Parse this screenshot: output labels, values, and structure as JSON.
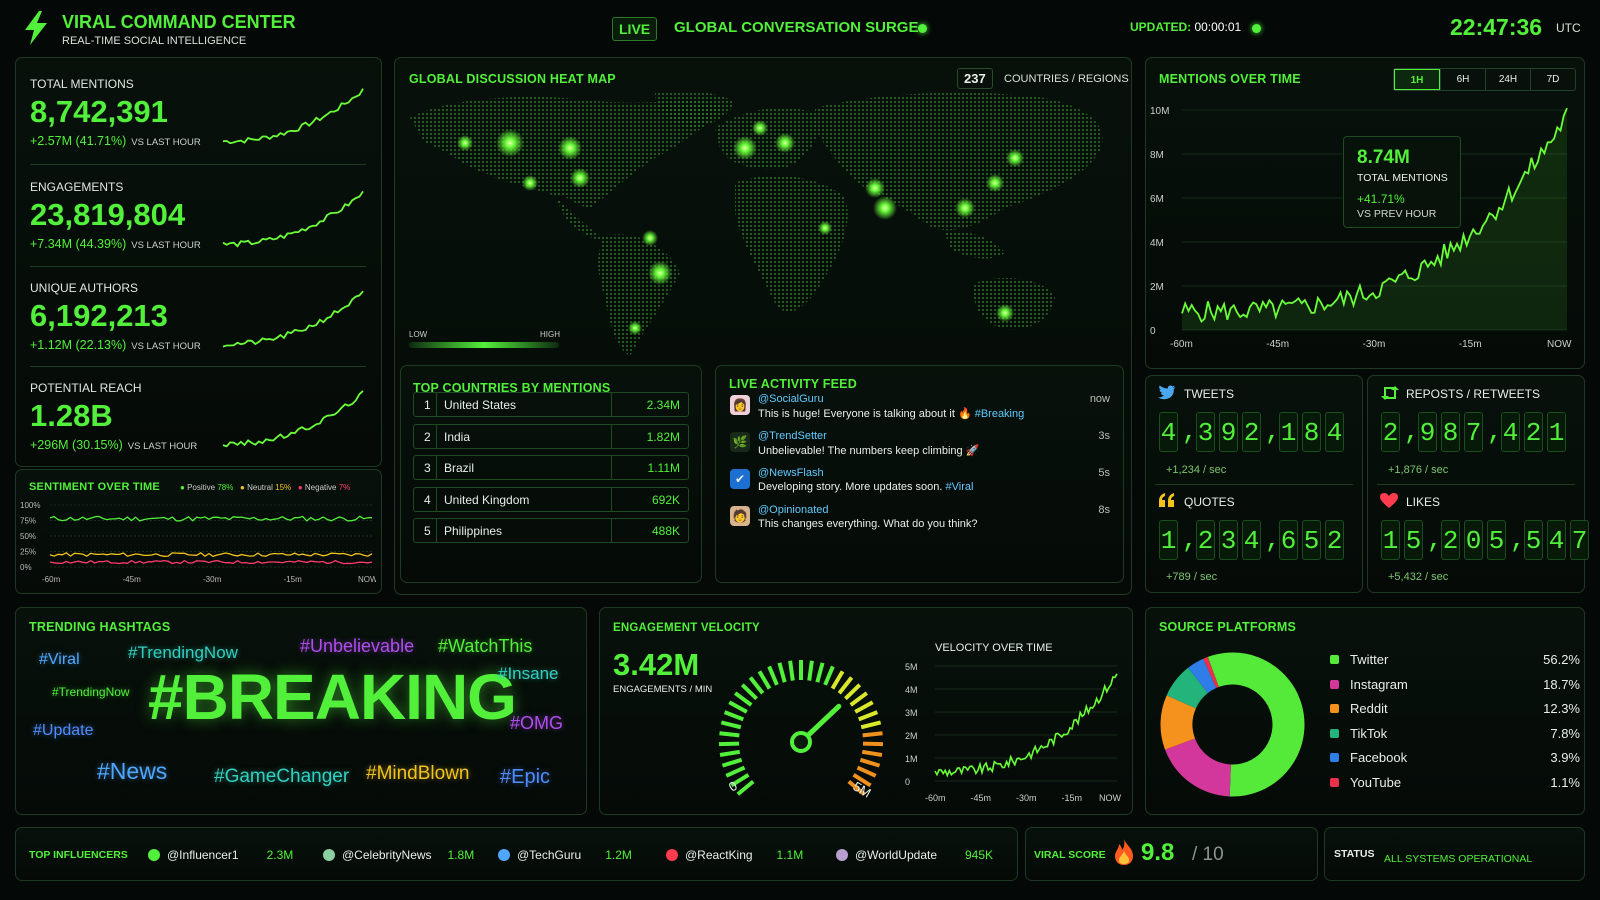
{
  "header": {
    "title": "VIRAL COMMAND CENTER",
    "subtitle": "REAL-TIME SOCIAL INTELLIGENCE",
    "live": "LIVE",
    "surge": "GLOBAL CONVERSATION SURGE",
    "updated_label": "UPDATED:",
    "updated_value": "00:00:01",
    "clock": "22:47:36",
    "tz": "UTC"
  },
  "kpis": [
    {
      "label": "TOTAL MENTIONS",
      "value": "8,742,391",
      "change": "+2.57M (41.71%)",
      "suffix": "VS LAST HOUR"
    },
    {
      "label": "ENGAGEMENTS",
      "value": "23,819,804",
      "change": "+7.34M (44.39%)",
      "suffix": "VS LAST HOUR"
    },
    {
      "label": "UNIQUE AUTHORS",
      "value": "6,192,213",
      "change": "+1.12M (22.13%)",
      "suffix": "VS LAST HOUR"
    },
    {
      "label": "POTENTIAL REACH",
      "value": "1.28B",
      "change": "+296M (30.15%)",
      "suffix": "VS LAST HOUR"
    }
  ],
  "sentiment": {
    "title": "SENTIMENT OVER TIME",
    "legend": [
      {
        "name": "Positive",
        "pct": "78%",
        "color": "#52f03a"
      },
      {
        "name": "Neutral",
        "pct": "15%",
        "color": "#f2c21d"
      },
      {
        "name": "Negative",
        "pct": "7%",
        "color": "#ff3b6e"
      }
    ],
    "yticks": [
      "100%",
      "75%",
      "50%",
      "25%",
      "0%"
    ],
    "xticks": [
      "-60m",
      "-45m",
      "-30m",
      "-15m",
      "NOW"
    ]
  },
  "heatmap": {
    "title": "GLOBAL DISCUSSION HEAT MAP",
    "count": "237",
    "count_label": "COUNTRIES / REGIONS",
    "low": "LOW",
    "high": "HIGH"
  },
  "countries": {
    "title": "TOP COUNTRIES BY MENTIONS",
    "rows": [
      {
        "rank": "1",
        "name": "United States",
        "value": "2.34M"
      },
      {
        "rank": "2",
        "name": "India",
        "value": "1.82M"
      },
      {
        "rank": "3",
        "name": "Brazil",
        "value": "1.11M"
      },
      {
        "rank": "4",
        "name": "United Kingdom",
        "value": "692K"
      },
      {
        "rank": "5",
        "name": "Philippines",
        "value": "488K"
      }
    ]
  },
  "feed": {
    "title": "LIVE ACTIVITY FEED",
    "items": [
      {
        "handle": "@SocialGuru",
        "text": "This is huge! Everyone is talking about it 🔥",
        "tag": "#Breaking",
        "time": "now"
      },
      {
        "handle": "@TrendSetter",
        "text": "Unbelievable! The numbers keep climbing 🚀",
        "tag": "",
        "time": "3s"
      },
      {
        "handle": "@NewsFlash",
        "text": "Developing story. More updates soon.",
        "tag": "#Viral",
        "time": "5s"
      },
      {
        "handle": "@Opinionated",
        "text": "This changes everything. What do you think?",
        "tag": "",
        "time": "8s"
      }
    ]
  },
  "mentions_chart": {
    "title": "MENTIONS OVER TIME",
    "ranges": [
      "1H",
      "6H",
      "24H",
      "7D"
    ],
    "selected": "1H",
    "callout_value": "8.74M",
    "callout_label": "TOTAL MENTIONS",
    "callout_change": "+41.71%",
    "callout_sub": "VS PREV HOUR"
  },
  "counters": [
    {
      "label": "TWEETS",
      "digits": "4,392,184",
      "rate": "+1,234 / sec",
      "icon": "twitter-icon"
    },
    {
      "label": "REPOSTS / RETWEETS",
      "digits": "2,987,421",
      "rate": "+1,876 / sec",
      "icon": "repost-icon"
    },
    {
      "label": "QUOTES",
      "digits": "1,234,652",
      "rate": "+789 / sec",
      "icon": "quote-icon"
    },
    {
      "label": "LIKES",
      "digits": "15,205,547",
      "rate": "+5,432 / sec",
      "icon": "heart-icon"
    }
  ],
  "hashtags": {
    "title": "TRENDING HASHTAGS",
    "items": [
      "#BREAKING",
      "#Viral",
      "#TrendingNow",
      "#Unbelievable",
      "#WatchThis",
      "#Insane",
      "#TrendingNow",
      "#Update",
      "#OMG",
      "#News",
      "#GameChanger",
      "#MindBlown",
      "#Epic"
    ]
  },
  "velocity": {
    "title": "ENGAGEMENT VELOCITY",
    "value": "3.42M",
    "unit": "ENGAGEMENTS / MIN",
    "gauge_min": "0",
    "gauge_max": "5M",
    "gauge_level": 0.68,
    "chart_title": "VELOCITY OVER TIME",
    "yticks": [
      "5M",
      "4M",
      "3M",
      "2M",
      "1M",
      "0"
    ],
    "xticks": [
      "-60m",
      "-45m",
      "-30m",
      "-15m",
      "NOW"
    ]
  },
  "platforms": {
    "title": "SOURCE PLATFORMS",
    "items": [
      {
        "name": "Twitter",
        "pct": "56.2%",
        "value": 56.2,
        "color": "#55ea3a"
      },
      {
        "name": "Instagram",
        "pct": "18.7%",
        "value": 18.7,
        "color": "#d3379b"
      },
      {
        "name": "Reddit",
        "pct": "12.3%",
        "value": 12.3,
        "color": "#f5921d"
      },
      {
        "name": "TikTok",
        "pct": "7.8%",
        "value": 7.8,
        "color": "#22b47a"
      },
      {
        "name": "Facebook",
        "pct": "3.9%",
        "value": 3.9,
        "color": "#2f7de8"
      },
      {
        "name": "YouTube",
        "pct": "1.1%",
        "value": 1.1,
        "color": "#e8324b"
      }
    ]
  },
  "footer": {
    "influencers_label": "TOP INFLUENCERS",
    "influencers": [
      {
        "handle": "@Influencer1",
        "value": "2.3M"
      },
      {
        "handle": "@CelebrityNews",
        "value": "1.8M"
      },
      {
        "handle": "@TechGuru",
        "value": "1.2M"
      },
      {
        "handle": "@ReactKing",
        "value": "1.1M"
      },
      {
        "handle": "@WorldUpdate",
        "value": "945K"
      }
    ],
    "viral_label": "VIRAL SCORE",
    "viral_score": "9.8",
    "viral_max": "/ 10",
    "status_label": "STATUS",
    "status_value": "ALL SYSTEMS OPERATIONAL"
  }
}
